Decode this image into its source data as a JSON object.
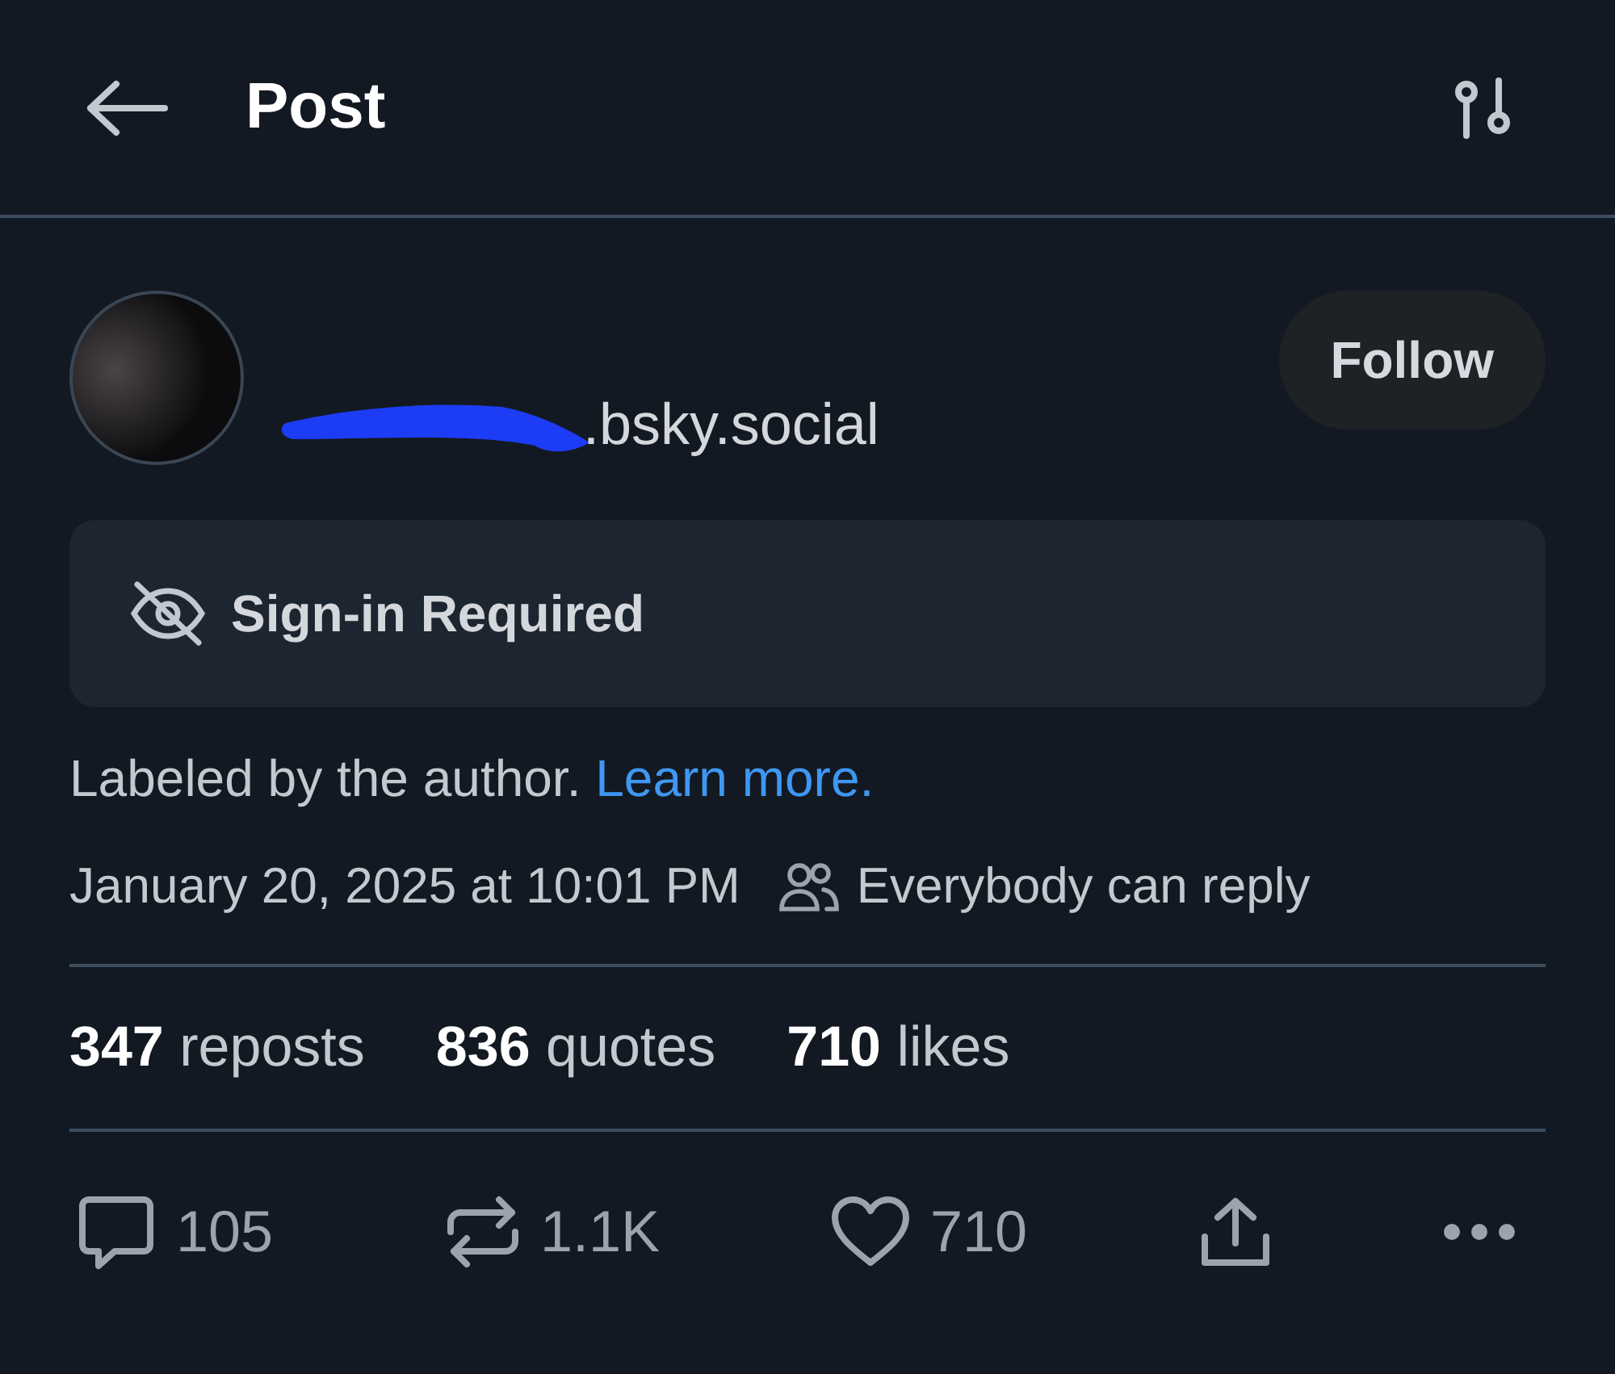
{
  "header": {
    "title": "Post"
  },
  "author": {
    "handle": ".bsky.social",
    "follow_label": "Follow"
  },
  "content_warning": {
    "label": "Sign-in Required"
  },
  "label_note": {
    "text": "Labeled by the author.",
    "link": "Learn more."
  },
  "meta": {
    "timestamp": "January 20, 2025 at 10:01 PM",
    "reply_setting": "Everybody can reply"
  },
  "stats": [
    {
      "count": "347",
      "label": "reposts"
    },
    {
      "count": "836",
      "label": "quotes"
    },
    {
      "count": "710",
      "label": "likes"
    }
  ],
  "actions": [
    {
      "kind": "reply",
      "count": "105"
    },
    {
      "kind": "repost",
      "count": "1.1K"
    },
    {
      "kind": "like",
      "count": "710"
    },
    {
      "kind": "share"
    },
    {
      "kind": "more"
    }
  ]
}
